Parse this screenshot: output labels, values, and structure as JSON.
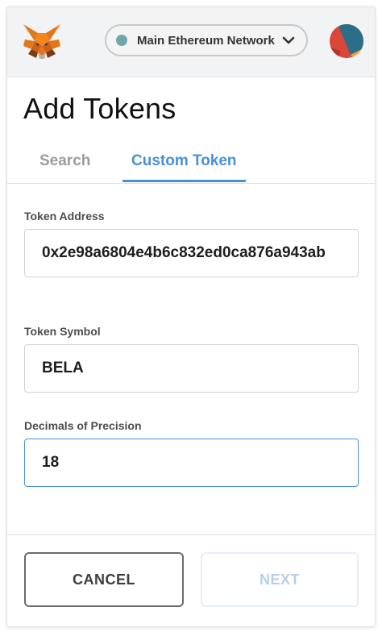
{
  "header": {
    "network_label": "Main Ethereum Network",
    "network_dot_color": "#6ea9a8",
    "logo_icon": "metamask-fox-icon",
    "avatar_icon": "identicon-avatar"
  },
  "page": {
    "title": "Add Tokens"
  },
  "tabs": [
    {
      "label": "Search",
      "active": false
    },
    {
      "label": "Custom Token",
      "active": true
    }
  ],
  "form": {
    "token_address": {
      "label": "Token Address",
      "value": "0x2e98a6804e4b6c832ed0ca876a943ab"
    },
    "token_symbol": {
      "label": "Token Symbol",
      "value": "BELA"
    },
    "decimals": {
      "label": "Decimals of Precision",
      "value": "18"
    }
  },
  "buttons": {
    "cancel": "CANCEL",
    "next": "NEXT"
  },
  "colors": {
    "accent": "#4a90d9",
    "next_disabled_text": "#b7cfe7"
  }
}
